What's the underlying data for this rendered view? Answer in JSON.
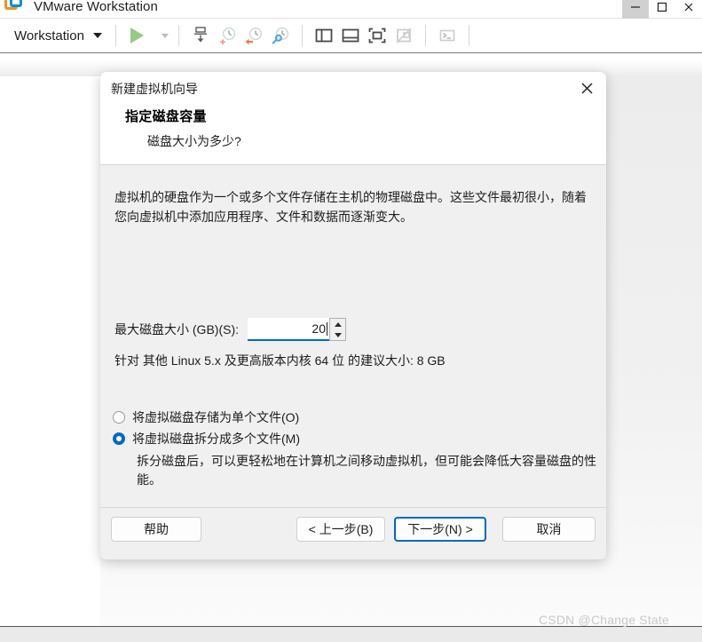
{
  "window": {
    "title": "VMware Workstation",
    "logo_icon": "vmware-logo-icon",
    "controls": {
      "minimize": "—",
      "maximize": "❐",
      "close": "✕"
    }
  },
  "toolbar": {
    "menu_label": "Workstation",
    "dropdown_icon": "chevron-down-icon",
    "items": [
      {
        "icon": "power-on-play-icon"
      },
      {
        "icon": "power-options-dropdown-icon"
      },
      {
        "icon": "manage-snapshot-icon"
      },
      {
        "icon": "take-snapshot-icon"
      },
      {
        "icon": "revert-snapshot-icon"
      },
      {
        "icon": "snapshot-manager-icon"
      },
      {
        "icon": "show-library-panel-icon"
      },
      {
        "icon": "show-thumbnail-bar-icon"
      },
      {
        "icon": "enter-full-screen-icon"
      },
      {
        "icon": "unity-mode-icon"
      },
      {
        "icon": "console-terminal-icon"
      }
    ]
  },
  "dialog": {
    "title": "新建虚拟机向导",
    "close_icon": "close-icon",
    "heading": "指定磁盘容量",
    "subheading": "磁盘大小为多少?",
    "intro": "虚拟机的硬盘作为一个或多个文件存储在主机的物理磁盘中。这些文件最初很小，随着您向虚拟机中添加应用程序、文件和数据而逐渐变大。",
    "field": {
      "label": "最大磁盘大小 (GB)(S):",
      "value": "20",
      "spin_up_icon": "spinner-up-icon",
      "spin_down_icon": "spinner-down-icon"
    },
    "hint": "针对 其他 Linux 5.x 及更高版本内核 64 位 的建议大小: 8 GB",
    "options": [
      {
        "label": "将虚拟磁盘存储为单个文件(O)",
        "selected": false
      },
      {
        "label": "将虚拟磁盘拆分成多个文件(M)",
        "selected": true
      }
    ],
    "option_description": "拆分磁盘后，可以更轻松地在计算机之间移动虚拟机，但可能会降低大容量磁盘的性能。",
    "buttons": {
      "help": "帮助",
      "back": "< 上一步(B)",
      "next": "下一步(N) >",
      "cancel": "取消"
    }
  },
  "watermark": "CSDN @Change State",
  "colors": {
    "accent_blue": "#0069c0",
    "logo_orange": "#f2921d",
    "logo_blue": "#0091da",
    "play_green": "#97ca84",
    "dialog_bg": "#f0f0f0"
  }
}
